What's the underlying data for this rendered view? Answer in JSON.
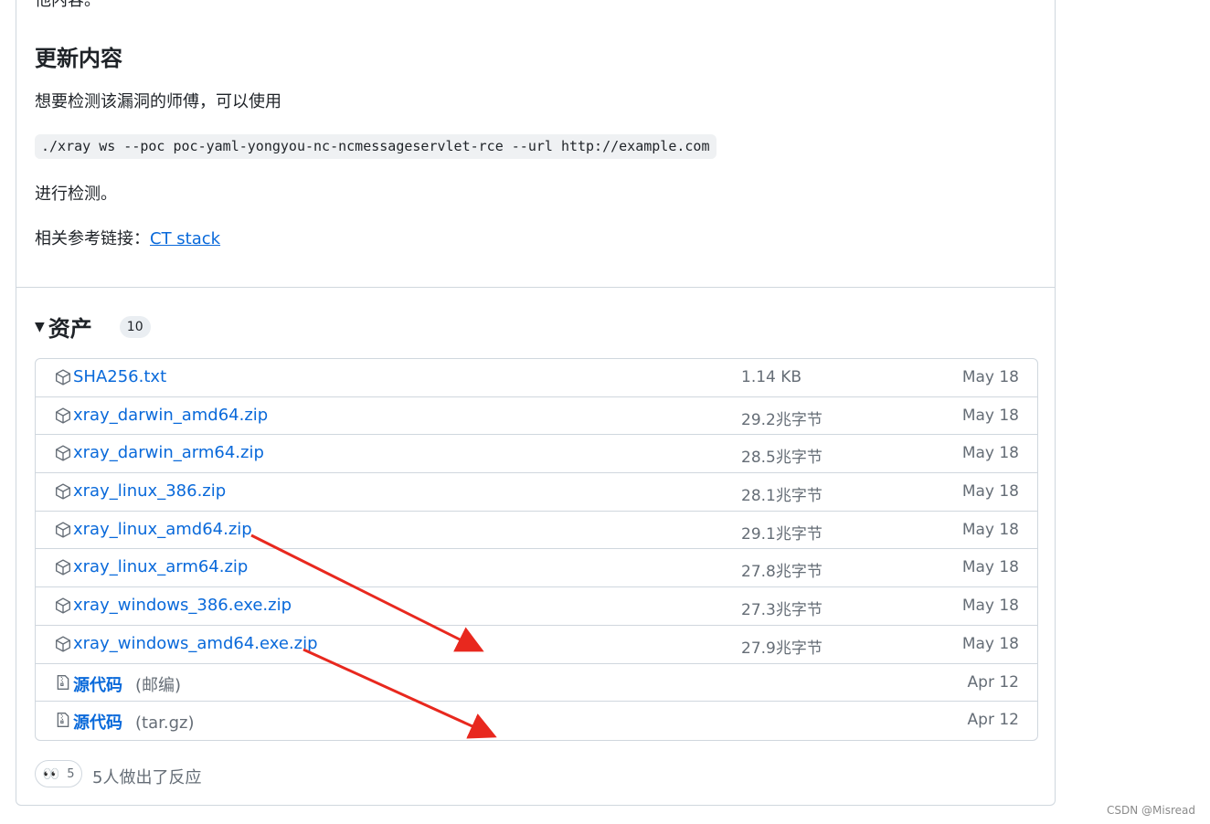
{
  "release": {
    "cutoff_text": "他内容。",
    "section_heading": "更新内容",
    "intro": "想要检测该漏洞的师傅，可以使用",
    "command": "./xray ws --poc poc-yaml-yongyou-nc-ncmessageservlet-rce --url http://example.com",
    "after_command": "进行检测。",
    "reference_label": "相关参考链接：",
    "reference_link": "CT stack"
  },
  "assets": {
    "title": "资产",
    "count": "10",
    "rows": [
      {
        "name": "SHA256.txt",
        "suffix": "",
        "size": "1.14 KB",
        "date": "May 18",
        "icon": "package-icon"
      },
      {
        "name": "xray_darwin_amd64.zip",
        "suffix": "",
        "size": "29.2兆字节",
        "date": "May 18",
        "icon": "package-icon"
      },
      {
        "name": "xray_darwin_arm64.zip",
        "suffix": "",
        "size": "28.5兆字节",
        "date": "May 18",
        "icon": "package-icon"
      },
      {
        "name": "xray_linux_386.zip",
        "suffix": "",
        "size": "28.1兆字节",
        "date": "May 18",
        "icon": "package-icon"
      },
      {
        "name": "xray_linux_amd64.zip",
        "suffix": "",
        "size": "29.1兆字节",
        "date": "May 18",
        "icon": "package-icon"
      },
      {
        "name": "xray_linux_arm64.zip",
        "suffix": "",
        "size": "27.8兆字节",
        "date": "May 18",
        "icon": "package-icon"
      },
      {
        "name": "xray_windows_386.exe.zip",
        "suffix": "",
        "size": "27.3兆字节",
        "date": "May 18",
        "icon": "package-icon"
      },
      {
        "name": "xray_windows_amd64.exe.zip",
        "suffix": "",
        "size": "27.9兆字节",
        "date": "May 18",
        "icon": "package-icon"
      },
      {
        "name": "源代码",
        "suffix": "(邮编)",
        "size": "",
        "date": "Apr 12",
        "icon": "file-zip-icon"
      },
      {
        "name": "源代码",
        "suffix": "(tar.gz)",
        "size": "",
        "date": "Apr 12",
        "icon": "file-zip-icon"
      }
    ]
  },
  "reactions": {
    "emoji": "👀",
    "count": "5",
    "text": "5人做出了反应"
  },
  "watermark": "CSDN @Misread",
  "colors": {
    "link": "#0969da",
    "muted": "#656d76",
    "border": "#d0d7de",
    "arrow": "#e8281e"
  }
}
